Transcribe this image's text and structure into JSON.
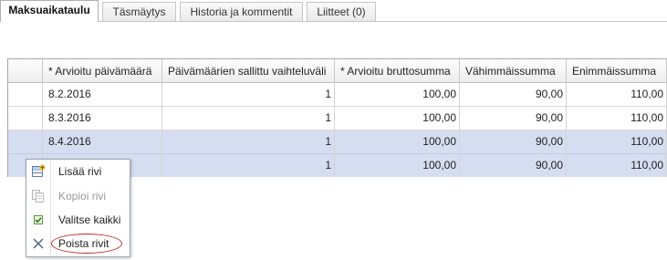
{
  "tabs": [
    {
      "label": "Maksuaikataulu",
      "active": true
    },
    {
      "label": "Täsmäytys",
      "active": false
    },
    {
      "label": "Historia ja kommentit",
      "active": false
    },
    {
      "label": "Liitteet (0)",
      "active": false
    }
  ],
  "table": {
    "columns": [
      "* Arvioitu päivämäärä",
      "Päivämäärien sallittu vaihteluväli",
      "* Arvioitu bruttosumma",
      "Vähimmäissumma",
      "Enimmäissumma"
    ],
    "rows": [
      {
        "date": "8.2.2016",
        "variance": "1",
        "gross": "100,00",
        "min": "90,00",
        "max": "110,00",
        "selected": false
      },
      {
        "date": "8.3.2016",
        "variance": "1",
        "gross": "100,00",
        "min": "90,00",
        "max": "110,00",
        "selected": false
      },
      {
        "date": "8.4.2016",
        "variance": "1",
        "gross": "100,00",
        "min": "90,00",
        "max": "110,00",
        "selected": true
      },
      {
        "date": "",
        "variance": "1",
        "gross": "100,00",
        "min": "90,00",
        "max": "110,00",
        "selected": true
      }
    ]
  },
  "context_menu": {
    "items": [
      {
        "label": "Lisää rivi",
        "icon": "add-row-icon",
        "enabled": true
      },
      {
        "label": "Kopioi rivi",
        "icon": "copy-row-icon",
        "enabled": false
      },
      {
        "label": "Valitse kaikki",
        "icon": "checkbox-checked-icon",
        "enabled": true
      },
      {
        "label": "Poista rivit",
        "icon": "delete-x-icon",
        "enabled": true,
        "highlighted": true
      }
    ]
  },
  "colors": {
    "selected_row": "#d5def0",
    "highlight_circle": "#c62828"
  }
}
